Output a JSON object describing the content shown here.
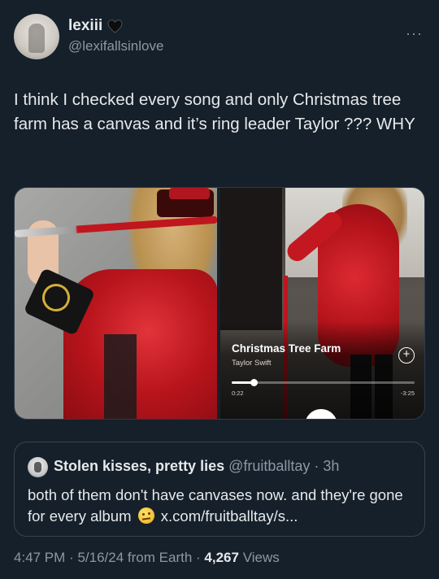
{
  "author": {
    "display_name": "lexiii",
    "handle": "@lexifallsinlove",
    "badge_icon": "black-heart-icon"
  },
  "menu_icon": "more-icon",
  "tweet": {
    "text": "I think I checked every song and only Christmas tree farm has a canvas and it’s ring leader Taylor ??? WHY"
  },
  "media": {
    "player": {
      "song_title": "Christmas Tree Farm",
      "artist": "Taylor Swift",
      "time_elapsed": "0:22",
      "time_remaining": "-3:25",
      "progress_fraction": 0.12,
      "add_icon": "plus-circle-icon"
    }
  },
  "quote_tweet": {
    "name": "Stolen kisses, pretty lies",
    "handle": "@fruitballtay",
    "separator": "·",
    "time": "3h",
    "text_before_emoji": "both of them don't have canvases now. and they're gone for every album",
    "emoji_icon": "raised-eyebrow-emoji",
    "link": "x.com/fruitballtay/s..."
  },
  "meta": {
    "time": "4:47 PM",
    "sep1": "·",
    "date": "5/16/24",
    "source": "from Earth",
    "sep2": "·",
    "views_count": "4,267",
    "views_label": "Views"
  },
  "colors": {
    "background": "#15202b",
    "primary_text": "#e7e9ea",
    "secondary_text": "#8b98a5",
    "border": "#38444d"
  }
}
